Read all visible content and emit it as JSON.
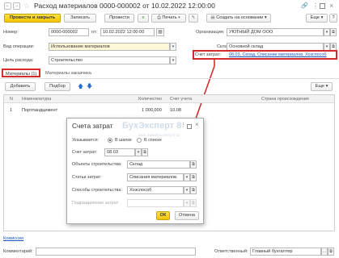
{
  "window": {
    "title": "Расход материалов 0000-000002 от 10.02.2022 12:00:00",
    "link_icon": "link-icon",
    "more_icon": "more-vertical-icon",
    "maximize_icon": "maximize-icon",
    "close_icon": "close-icon"
  },
  "toolbar": {
    "post_close": "Провести и закрыть",
    "save": "Записать",
    "post": "Провести",
    "print": "Печать",
    "create_based": "Создать на основании",
    "more": "Еще",
    "help": "?"
  },
  "form": {
    "number_label": "Номер:",
    "number_value": "0000-000002",
    "date_label": "от:",
    "date_value": "10.02.2022 12:00:00",
    "org_label": "Организация:",
    "org_value": "УЮТНЫЙ ДОМ ООО",
    "optype_label": "Вид операции:",
    "optype_value": "Использование материалов",
    "warehouse_label": "Склад:",
    "warehouse_value": "Основной склад",
    "purpose_label": "Цель расхода:",
    "purpose_value": "Строительство",
    "cost_account_label": "Счет затрат:",
    "cost_account_value": "08.03, Склад, Списание материалов, Хозспособ"
  },
  "tabs": [
    {
      "label": "Материалы (1)"
    },
    {
      "label": "Материалы заказчика"
    }
  ],
  "table_toolbar": {
    "add": "Добавить",
    "pick": "Подбор",
    "more": "Еще"
  },
  "table": {
    "headers": {
      "n": "N",
      "item": "Номенклатура",
      "qty": "Количество",
      "account": "Счет учета",
      "country": "Страна происхождения"
    },
    "rows": [
      {
        "n": "1",
        "item": "Портландцемент",
        "qty": "1 000,000",
        "account": "10.08"
      }
    ]
  },
  "dialog": {
    "title": "Счета затрат",
    "specify_label": "Указывается:",
    "opt_header": "В шапке",
    "opt_list": "В списке",
    "account_label": "Счет затрат:",
    "account_value": "08.03",
    "object_label": "Объекты строительства:",
    "object_value": "Склад",
    "cost_item_label": "Статьи затрат:",
    "cost_item_value": "Списания материалов",
    "method_label": "Способы строительства:",
    "method_value": "Хозспособ",
    "dept_label": "Подразделение затрат:",
    "ok": "ОК",
    "cancel": "Отмена",
    "watermark": "БухЭксперт 8",
    "watermark_sub": "База знаний по учету в 1С"
  },
  "footer": {
    "commission_link": "Комиссия",
    "comment_label": "Комментарий:",
    "responsible_label": "Ответственный:",
    "responsible_value": "Главный бухгалтер"
  },
  "colors": {
    "accent_red": "#d62b2b",
    "primary_yellow": "#f5c400",
    "link_blue": "#1a55c0"
  }
}
